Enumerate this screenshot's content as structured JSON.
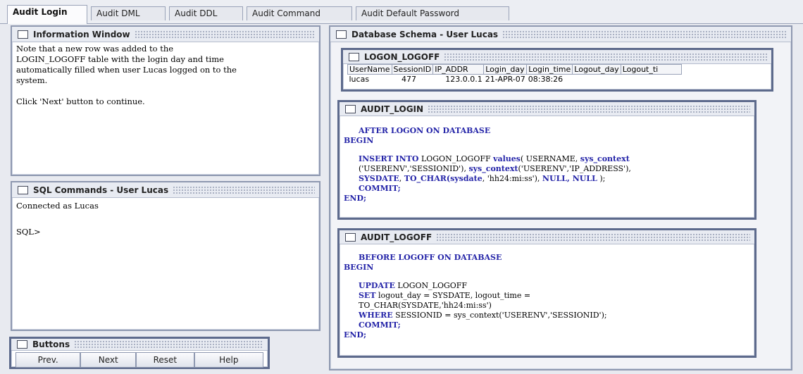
{
  "tabs": [
    {
      "label": "Audit Login",
      "active": true
    },
    {
      "label": "Audit DML",
      "active": false
    },
    {
      "label": "Audit DDL",
      "active": false
    },
    {
      "label": "Audit Command",
      "active": false
    },
    {
      "label": "Audit Default Password",
      "active": false
    }
  ],
  "info_window": {
    "title": "Information Window",
    "lines": [
      "Note that a new row was added to the",
      "LOGIN_LOGOFF table with the login day and time",
      "automatically filled when user Lucas logged on to the",
      "system.",
      "",
      "Click 'Next' button to continue."
    ]
  },
  "sql_window": {
    "title": "SQL Commands - User Lucas",
    "connected": "Connected as Lucas",
    "prompt": "SQL>"
  },
  "buttons_panel": {
    "title": "Buttons",
    "prev": "Prev.",
    "next": "Next",
    "reset": "Reset",
    "help": "Help"
  },
  "schema": {
    "title": "Database Schema - User Lucas",
    "logon_table": {
      "title": "LOGON_LOGOFF",
      "columns": [
        "UserName",
        "SessionID",
        "IP_ADDR",
        "Login_day",
        "Login_time",
        "Logout_day",
        "Logout_ti"
      ],
      "rows": [
        [
          "lucas",
          "477",
          "123.0.0.1",
          "21-APR-07",
          "08:38:26",
          "",
          ""
        ]
      ]
    },
    "audit_login": {
      "title": "AUDIT_LOGIN",
      "line1": "AFTER LOGON ON DATABASE",
      "begin": "BEGIN",
      "insert_kw": "INSERT INTO",
      "insert_rest": " LOGON_LOGOFF ",
      "values_kw": "values",
      "values_rest": "( USERNAME, ",
      "sys1": "sys_context",
      "line_b1": "('USERENV','SESSIONID'), ",
      "sys2": "sys_context",
      "line_b2": "('USERENV','IP_ADDRESS'),",
      "sysdate": "SYSDATE",
      "to_char": "TO_CHAR(sysdate",
      "to_char_rest": ", 'hh24:mi:ss'), ",
      "nulls": "NULL, NULL",
      "close": " );",
      "commit": "COMMIT;",
      "end": "END;"
    },
    "audit_logoff": {
      "title": "AUDIT_LOGOFF",
      "line1": "BEFORE LOGOFF ON DATABASE",
      "begin": "BEGIN",
      "update_kw": "UPDATE",
      "update_rest": " LOGON_LOGOFF",
      "set_kw": "SET",
      "set_rest": " logout_day = SYSDATE, logout_time =",
      "to_char_line": "TO_CHAR(SYSDATE,'hh24:mi:ss')",
      "where_kw": "WHERE",
      "where_rest": " SESSIONID = sys_context('USERENV','SESSIONID');",
      "commit": "COMMIT;",
      "end": "END;"
    }
  }
}
